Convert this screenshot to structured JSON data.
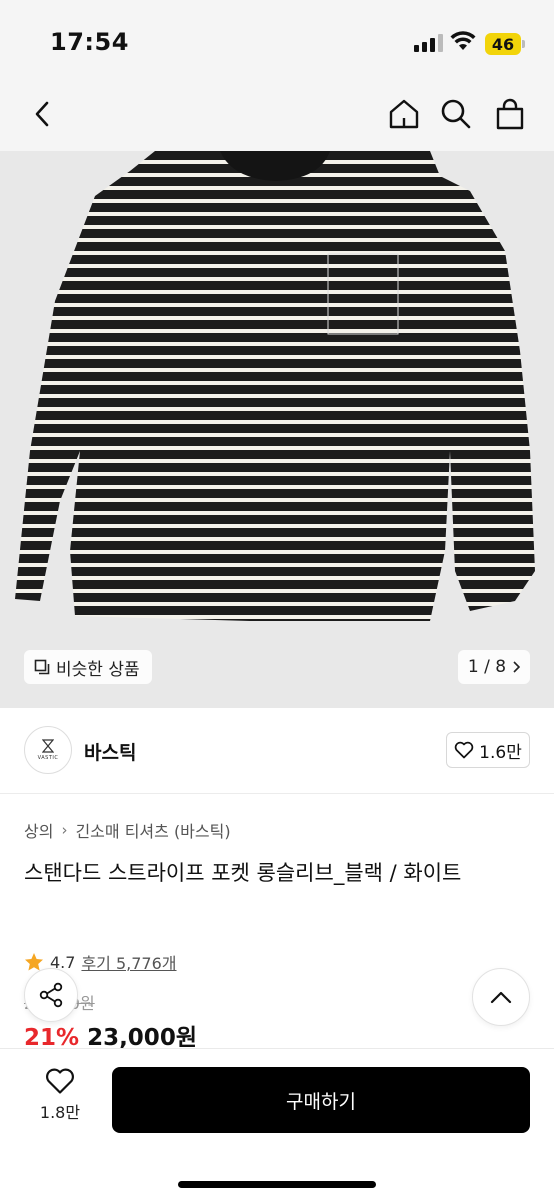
{
  "status_bar": {
    "time": "17:54",
    "battery": "46",
    "battery_color": "#f2d40a"
  },
  "nav": {
    "icons": [
      "back-icon",
      "home-icon",
      "search-icon",
      "shopping-bag-icon"
    ]
  },
  "gallery": {
    "similar_label": "비슷한 상품",
    "counter": "1 / 8"
  },
  "brand": {
    "logo_text": "VASTIC",
    "name": "바스틱",
    "likes": "1.6만"
  },
  "breadcrumb": {
    "category": "상의",
    "subcategory": "긴소매 티셔츠 (바스틱)"
  },
  "product": {
    "title": "스탠다드 스트라이프 포켓 롱슬리브_블랙 / 화이트",
    "rating": "4.7",
    "reviews": "후기 5,776개",
    "original_price": "29,000원",
    "discount": "21%",
    "price": "23,000원",
    "discount_color": "#e8282c"
  },
  "bottom": {
    "wish_count": "1.8만",
    "buy_label": "구매하기"
  }
}
